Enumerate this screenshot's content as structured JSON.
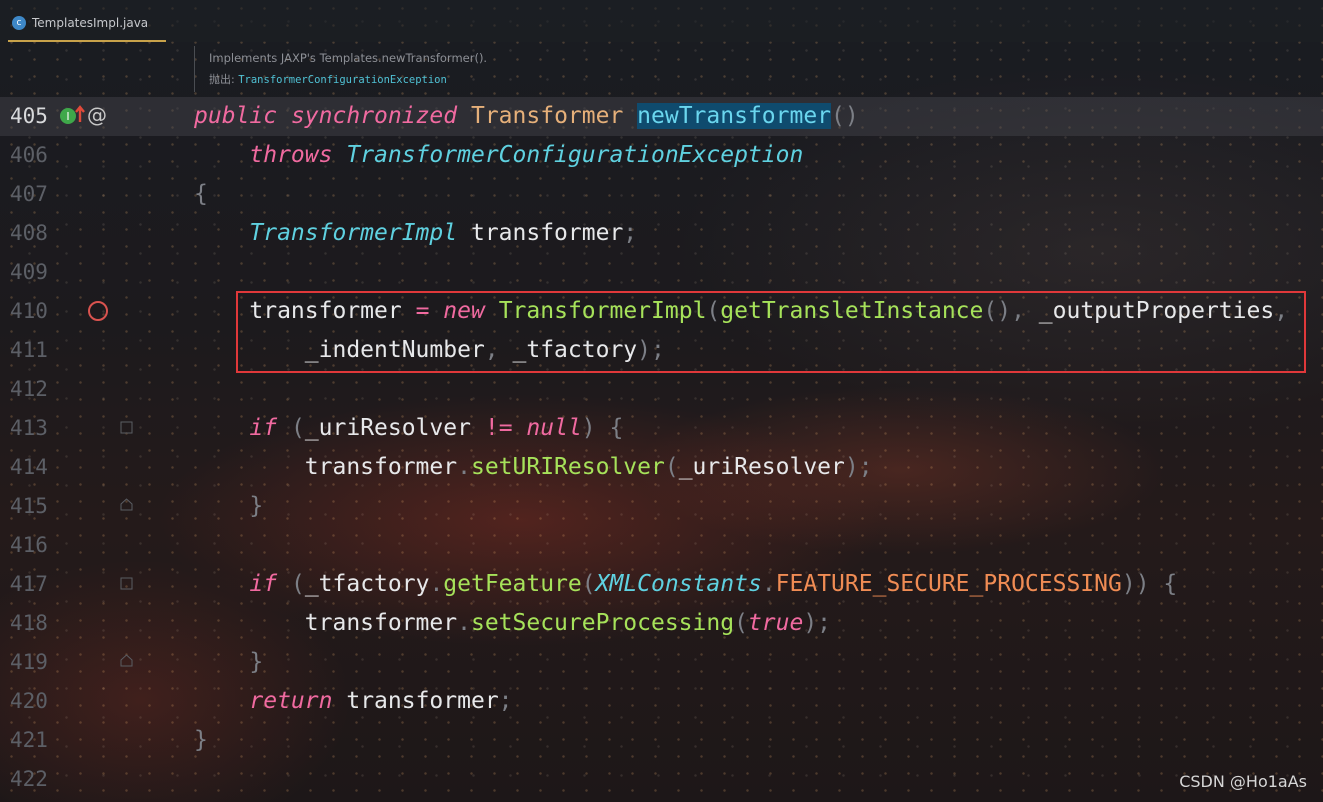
{
  "tab": {
    "filename": "TemplatesImpl.java",
    "icon": "java-class-icon"
  },
  "doc": {
    "line1": "Implements JAXP's Templates.newTransformer().",
    "throws_label": "抛出:",
    "throws_class": "TransformerConfigurationException"
  },
  "line_numbers": [
    "405",
    "406",
    "407",
    "408",
    "409",
    "410",
    "411",
    "412",
    "413",
    "414",
    "415",
    "416",
    "417",
    "418",
    "419",
    "420",
    "421",
    "422"
  ],
  "code": {
    "l405": {
      "kw1": "public",
      "kw2": "synchronized",
      "type": "Transformer",
      "method": "newTransformer",
      "parens": "()"
    },
    "l406": {
      "kw": "throws",
      "type": "TransformerConfigurationException"
    },
    "l407": {
      "text": "{"
    },
    "l408": {
      "type": "TransformerImpl",
      "var": "transformer",
      "semi": ";"
    },
    "l410": {
      "var": "transformer",
      "op": "=",
      "kw": "new",
      "ctor": "TransformerImpl",
      "p1": "(",
      "call": "getTransletInstance",
      "p2": "(),",
      "arg": "_outputProperties",
      "comma": ","
    },
    "l411": {
      "arg1": "_indentNumber",
      "comma": ",",
      "arg2": "_tfactory",
      "end": ");"
    },
    "l413": {
      "kw": "if",
      "p1": "(",
      "var": "_uriResolver",
      "op": "!=",
      "nul": "null",
      "p2": ")",
      "brace": "{"
    },
    "l414": {
      "var": "transformer",
      "dot": ".",
      "call": "setURIResolver",
      "p1": "(",
      "arg": "_uriResolver",
      "end": ");"
    },
    "l415": {
      "text": "}"
    },
    "l417": {
      "kw": "if",
      "p1": "(",
      "var": "_tfactory",
      "dot": ".",
      "call": "getFeature",
      "p2": "(",
      "cls": "XMLConstants",
      "dot2": ".",
      "const": "FEATURE_SECURE_PROCESSING",
      "p3": "))",
      "brace": "{"
    },
    "l418": {
      "var": "transformer",
      "dot": ".",
      "call": "setSecureProcessing",
      "p1": "(",
      "val": "true",
      "end": ");"
    },
    "l419": {
      "text": "}"
    },
    "l420": {
      "kw": "return",
      "var": "transformer",
      "semi": ";"
    },
    "l421": {
      "text": "}"
    }
  },
  "watermark": "CSDN @Ho1aAs"
}
